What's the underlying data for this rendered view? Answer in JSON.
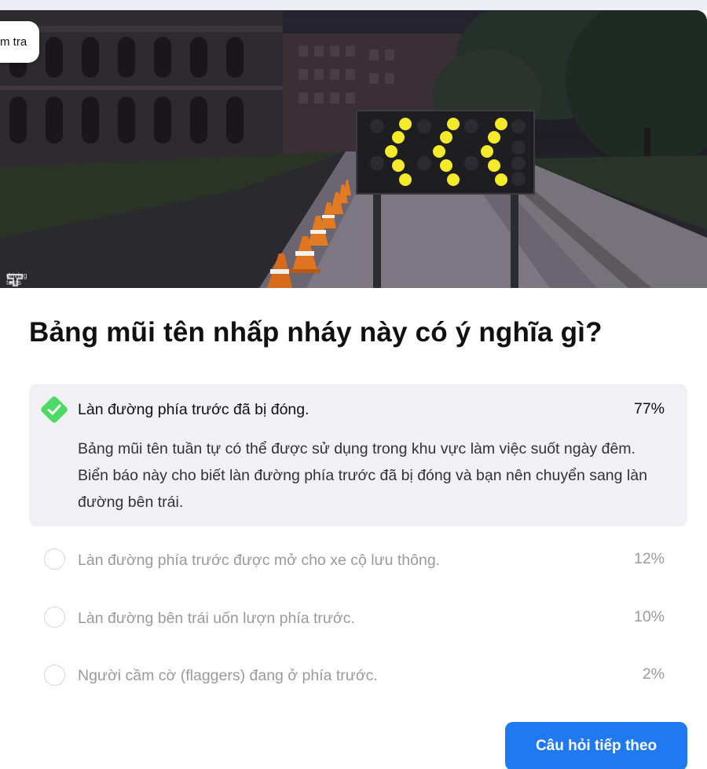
{
  "hero": {
    "check_chip_label": "m tra",
    "watermark_text": "driving tests",
    "image_subject": "flashing arrow board with three left-pointing chevrons of yellow lamps beside traffic cones on a road at night"
  },
  "question": {
    "title": "Bảng mũi tên nhấp nháy này có ý nghĩa gì?"
  },
  "answers": [
    {
      "label": "Làn đường phía trước đã bị đóng.",
      "percent": "77%",
      "explanation": "Bảng mũi tên tuần tự có thể được sử dụng trong khu vực làm việc suốt ngày đêm. Biển báo này cho biết làn đường phía trước đã bị đóng và bạn nên chuyển sang làn đường bên trái."
    },
    {
      "label": "Làn đường phía trước được mở cho xe cộ lưu thông.",
      "percent": "12%"
    },
    {
      "label": "Làn đường bên trái uốn lượn phía trước.",
      "percent": "10%"
    },
    {
      "label": "Người cầm cờ (flaggers) đang ở phía trước.",
      "percent": "2%"
    }
  ],
  "footer": {
    "next_button_label": "Câu hỏi tiếp theo"
  },
  "colors": {
    "correct_green": "#4cd964",
    "button_blue": "#1f7af2",
    "selected_bg": "#f1f0f5",
    "lamp_yellow": "#f4ea2a"
  },
  "icons": [
    "check-diamond-icon",
    "radio-circle-icon",
    "driving-tests-logo-icon"
  ]
}
